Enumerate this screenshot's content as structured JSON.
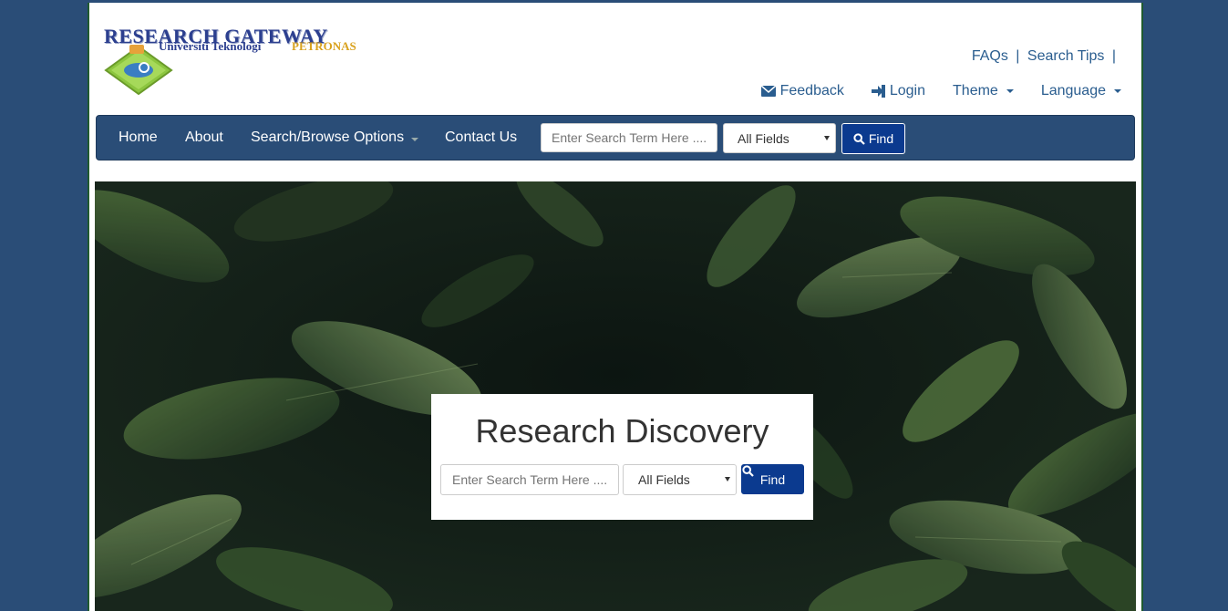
{
  "logo": {
    "title": "RESEARCH GATEWAY",
    "subtitle_a": "Universiti Teknologi",
    "subtitle_b": "PETRONAS"
  },
  "top_links": {
    "faqs": "FAQs",
    "sep1": "|",
    "search_tips": "Search Tips",
    "sep2": "|"
  },
  "utility_menu": {
    "feedback": "Feedback",
    "login": "Login",
    "theme": "Theme",
    "language": "Language"
  },
  "navbar": {
    "items": [
      {
        "label": "Home"
      },
      {
        "label": "About"
      },
      {
        "label": "Search/Browse Options"
      },
      {
        "label": "Contact Us"
      }
    ],
    "search_placeholder": "Enter Search Term Here ....",
    "field_select": "All Fields",
    "find_label": "Find"
  },
  "hero": {
    "heading": "Research Discovery",
    "search_placeholder": "Enter Search Term Here ....",
    "field_select": "All Fields",
    "find_label": "Find"
  },
  "colors": {
    "background": "#2a4d77",
    "navbar": "#2a4d77",
    "find_button": "#0b3a8f",
    "link": "#2a5d8f"
  }
}
